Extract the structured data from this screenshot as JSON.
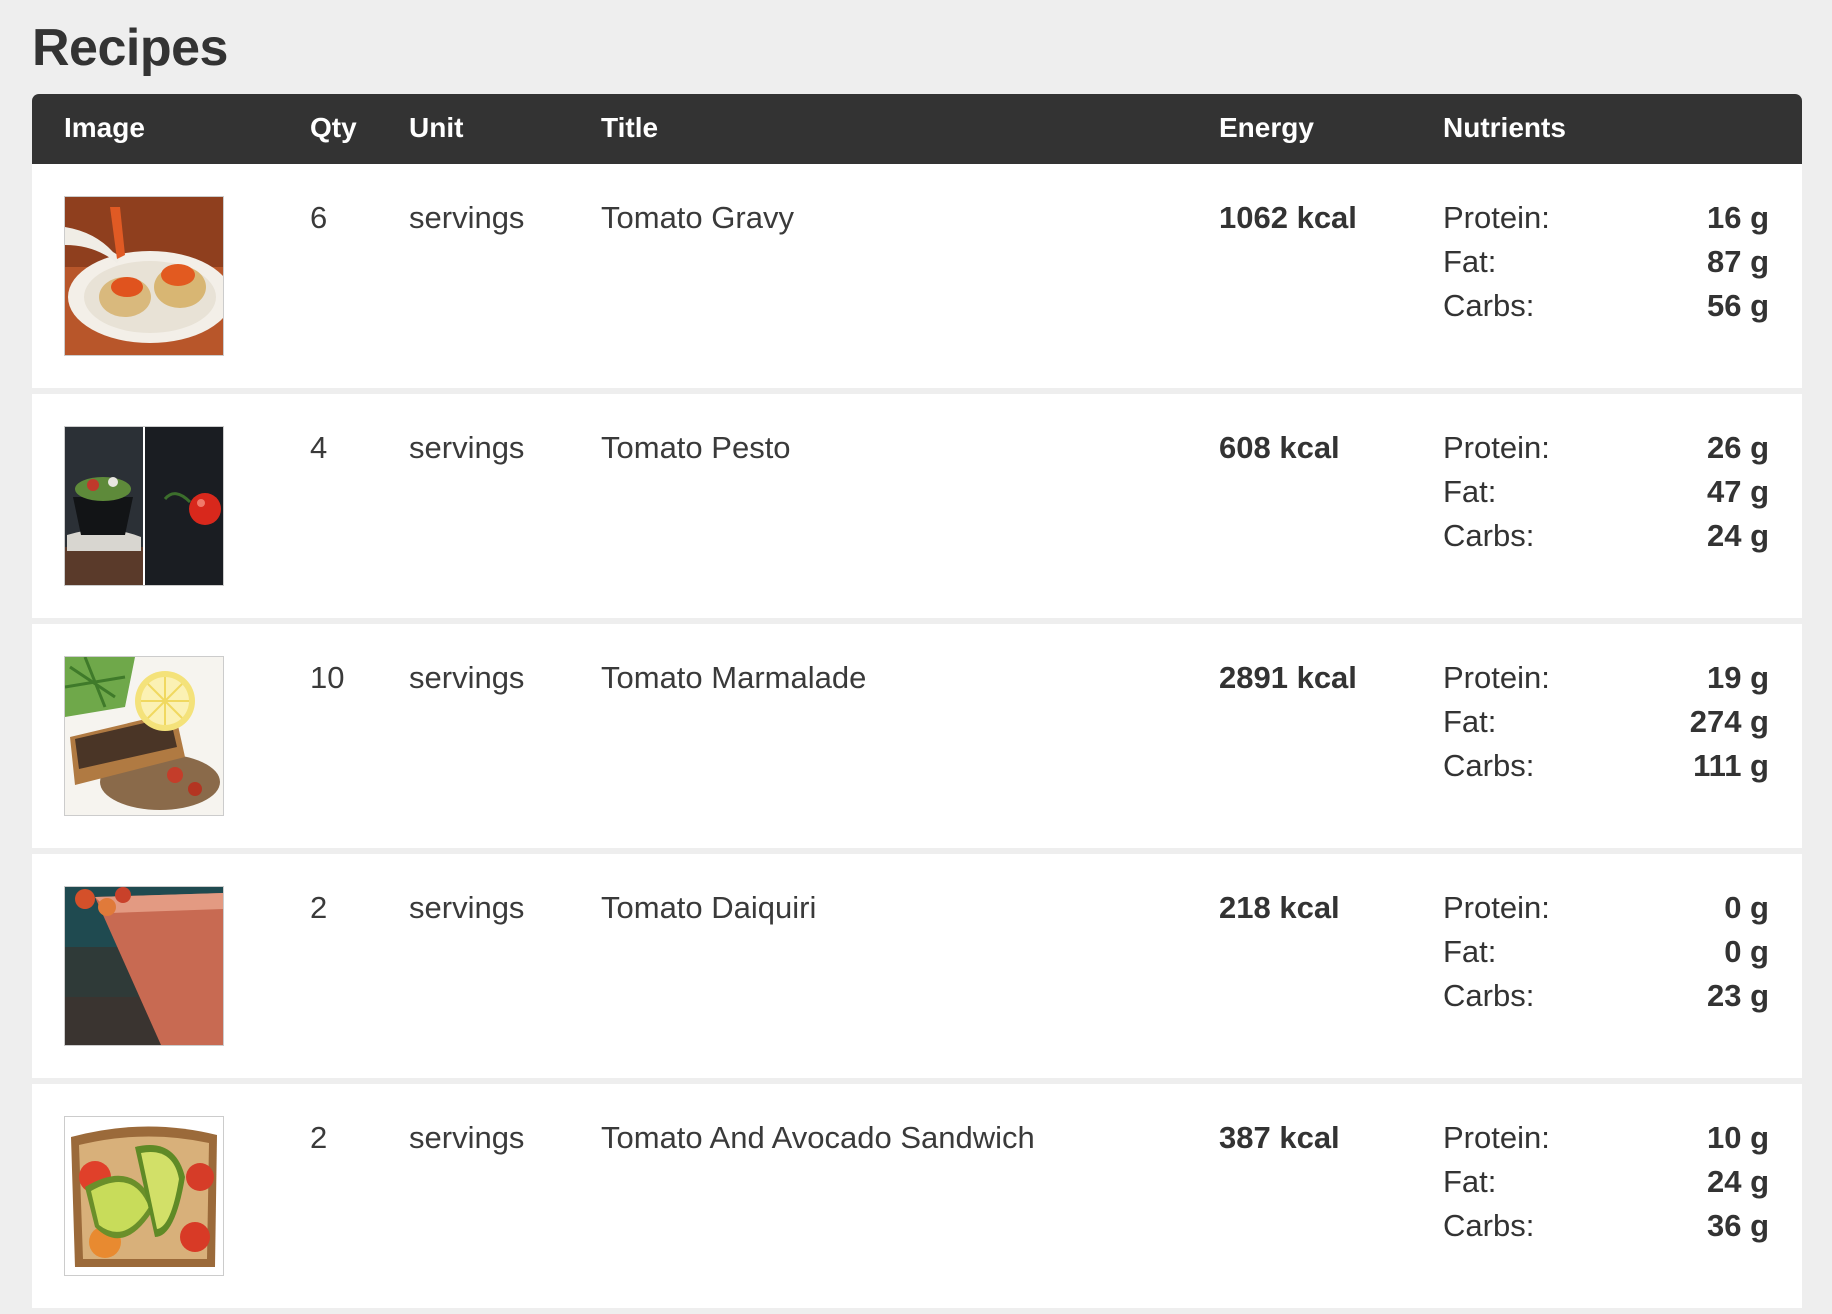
{
  "page": {
    "title": "Recipes"
  },
  "table": {
    "headers": {
      "image": "Image",
      "qty": "Qty",
      "unit": "Unit",
      "title": "Title",
      "energy": "Energy",
      "nutrients": "Nutrients"
    },
    "nutrient_labels": {
      "protein": "Protein:",
      "fat": "Fat:",
      "carbs": "Carbs:"
    },
    "rows": [
      {
        "image_icon": "tomato-gravy-photo",
        "qty": "6",
        "unit": "servings",
        "title": "Tomato Gravy",
        "energy": "1062 kcal",
        "protein": "16 g",
        "fat": "87 g",
        "carbs": "56 g"
      },
      {
        "image_icon": "tomato-pesto-photo",
        "qty": "4",
        "unit": "servings",
        "title": "Tomato Pesto",
        "energy": "608 kcal",
        "protein": "26 g",
        "fat": "47 g",
        "carbs": "24 g"
      },
      {
        "image_icon": "tomato-marmalade-photo",
        "qty": "10",
        "unit": "servings",
        "title": "Tomato Marmalade",
        "energy": "2891 kcal",
        "protein": "19 g",
        "fat": "274 g",
        "carbs": "111 g"
      },
      {
        "image_icon": "tomato-daiquiri-photo",
        "qty": "2",
        "unit": "servings",
        "title": "Tomato Daiquiri",
        "energy": "218 kcal",
        "protein": "0 g",
        "fat": "0 g",
        "carbs": "23 g"
      },
      {
        "image_icon": "tomato-avocado-sandwich-photo",
        "qty": "2",
        "unit": "servings",
        "title": "Tomato And Avocado Sandwich",
        "energy": "387 kcal",
        "protein": "10 g",
        "fat": "24 g",
        "carbs": "36 g"
      }
    ]
  },
  "colors": {
    "header_bg": "#333333",
    "page_bg": "#eeeeee",
    "row_bg": "#ffffff",
    "text": "#333333"
  }
}
